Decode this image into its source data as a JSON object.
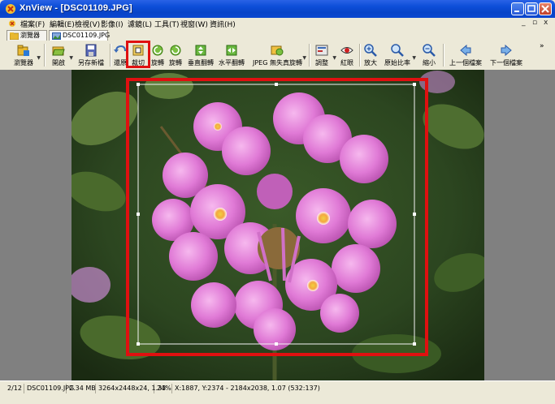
{
  "window": {
    "title": "XnView - [DSC01109.JPG]"
  },
  "menubar": {
    "items": [
      "檔案(F)",
      "編輯(E)",
      "檢視(V)",
      "影像(I)",
      "濾鏡(L)",
      "工具(T)",
      "視窗(W)",
      "資訊(H)"
    ],
    "right_controls": [
      "_",
      "▫",
      "x"
    ]
  },
  "tabs": [
    {
      "label": "瀏覽器"
    },
    {
      "label": "DSC01109.JPG"
    }
  ],
  "toolbar": {
    "items": [
      {
        "label": "瀏覽器",
        "icon": "browser-folder-icon"
      },
      {
        "label": "開啟",
        "icon": "open-folder-icon"
      },
      {
        "label": "另存新檔",
        "icon": "save-disk-icon"
      },
      {
        "label": "還原",
        "icon": "undo-icon"
      },
      {
        "label": "裁切",
        "icon": "crop-icon"
      },
      {
        "label": "旋轉",
        "icon": "rotate-left-icon"
      },
      {
        "label": "旋轉",
        "icon": "rotate-right-icon"
      },
      {
        "label": "垂直翻轉",
        "icon": "flip-vertical-icon"
      },
      {
        "label": "水平翻轉",
        "icon": "flip-horizontal-icon"
      },
      {
        "label": "JPEG 無失真旋轉",
        "icon": "jpeg-rotate-icon"
      },
      {
        "label": "調整",
        "icon": "adjust-icon"
      },
      {
        "label": "紅眼",
        "icon": "red-eye-icon"
      },
      {
        "label": "放大",
        "icon": "zoom-in-icon"
      },
      {
        "label": "原始比率",
        "icon": "zoom-fit-icon"
      },
      {
        "label": "縮小",
        "icon": "zoom-out-icon"
      },
      {
        "label": "上一個檔案",
        "icon": "prev-arrow-icon"
      },
      {
        "label": "下一個檔案",
        "icon": "next-arrow-icon"
      }
    ],
    "overflow": "»"
  },
  "statusbar": {
    "cells": [
      "2/12",
      "DSC01109.JPG",
      "2.34 MB",
      "3264x2448x24, 1.33",
      "24%",
      "X:1887, Y:2374 - 2184x2038, 1.07 (532:137)"
    ]
  },
  "colors": {
    "highlight": "#e01010",
    "titlebar": "#0a47d0",
    "viewer_bg": "#808080"
  }
}
